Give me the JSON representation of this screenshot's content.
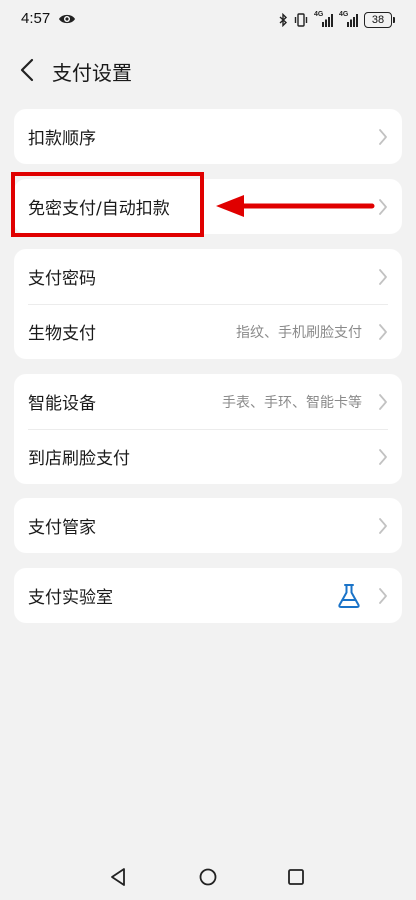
{
  "status_bar": {
    "time": "4:57",
    "signal_1": "4G",
    "signal_2": "4G",
    "battery": "38"
  },
  "header": {
    "title": "支付设置"
  },
  "cards": [
    {
      "rows": [
        {
          "label": "扣款顺序",
          "value": ""
        }
      ]
    },
    {
      "rows": [
        {
          "label": "免密支付/自动扣款",
          "value": ""
        }
      ]
    },
    {
      "rows": [
        {
          "label": "支付密码",
          "value": ""
        },
        {
          "label": "生物支付",
          "value": "指纹、手机刷脸支付"
        }
      ]
    },
    {
      "rows": [
        {
          "label": "智能设备",
          "value": "手表、手环、智能卡等"
        },
        {
          "label": "到店刷脸支付",
          "value": ""
        }
      ]
    },
    {
      "rows": [
        {
          "label": "支付管家",
          "value": ""
        }
      ]
    },
    {
      "rows": [
        {
          "label": "支付实验室",
          "value": "",
          "icon": "flask-icon"
        }
      ]
    }
  ],
  "colors": {
    "background": "#f2f2f2",
    "card": "#ffffff",
    "annotation": "#e00000",
    "flask_icon": "#1a73c8",
    "secondary_text": "#8a8a8a"
  }
}
